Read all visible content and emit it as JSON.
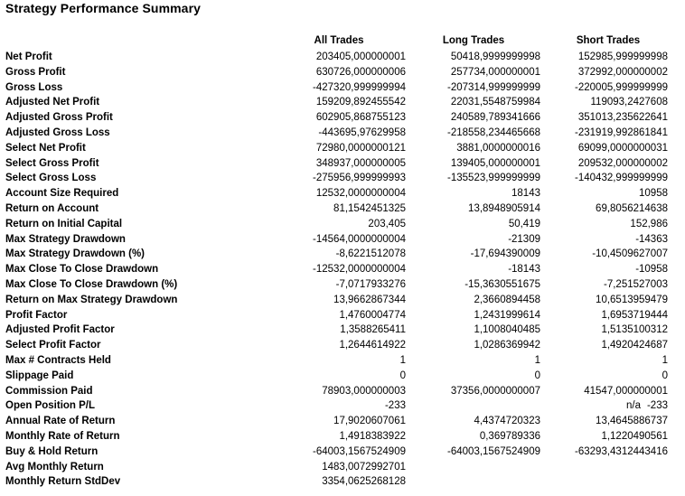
{
  "report": {
    "title": "Strategy Performance Summary",
    "columns": [
      "",
      "All Trades",
      "Long Trades",
      "Short Trades"
    ],
    "rows": [
      {
        "label": "Net Profit",
        "all": "203405,000000001",
        "long": "50418,9999999998",
        "short": "152985,999999998"
      },
      {
        "label": "Gross Profit",
        "all": "630726,000000006",
        "long": "257734,000000001",
        "short": "372992,000000002"
      },
      {
        "label": "Gross Loss",
        "all": "-427320,999999994",
        "long": "-207314,999999999",
        "short": "-220005,999999999"
      },
      {
        "label": "Adjusted Net Profit",
        "all": "159209,892455542",
        "long": "22031,5548759984",
        "short": "119093,2427608"
      },
      {
        "label": "Adjusted Gross Profit",
        "all": "602905,868755123",
        "long": "240589,789341666",
        "short": "351013,235622641"
      },
      {
        "label": "Adjusted Gross Loss",
        "all": "-443695,97629958",
        "long": "-218558,234465668",
        "short": "-231919,992861841"
      },
      {
        "label": "Select Net Profit",
        "all": "72980,0000000121",
        "long": "3881,0000000016",
        "short": "69099,0000000031"
      },
      {
        "label": "Select Gross Profit",
        "all": "348937,000000005",
        "long": "139405,000000001",
        "short": "209532,000000002"
      },
      {
        "label": "Select Gross Loss",
        "all": "-275956,999999993",
        "long": "-135523,999999999",
        "short": "-140432,999999999"
      },
      {
        "label": "Account Size Required",
        "all": "12532,0000000004",
        "long": "18143",
        "short": "10958"
      },
      {
        "label": "Return on Account",
        "all": "81,1542451325",
        "long": "13,8948905914",
        "short": "69,8056214638"
      },
      {
        "label": "Return on Initial Capital",
        "all": "203,405",
        "long": "50,419",
        "short": "152,986"
      },
      {
        "label": "Max Strategy Drawdown",
        "all": "-14564,0000000004",
        "long": "-21309",
        "short": "-14363"
      },
      {
        "label": "Max Strategy Drawdown (%)",
        "all": "-8,6221512078",
        "long": "-17,694390009",
        "short": "-10,4509627007"
      },
      {
        "label": "Max Close To Close Drawdown",
        "all": "-12532,0000000004",
        "long": "-18143",
        "short": "-10958"
      },
      {
        "label": "Max Close To Close Drawdown (%)",
        "all": "-7,0717933276",
        "long": "-15,3630551675",
        "short": "-7,251527003"
      },
      {
        "label": "Return on Max Strategy Drawdown",
        "all": "13,9662867344",
        "long": "2,3660894458",
        "short": "10,6513959479"
      },
      {
        "label": "Profit Factor",
        "all": "1,4760004774",
        "long": "1,2431999614",
        "short": "1,6953719444"
      },
      {
        "label": "Adjusted Profit Factor",
        "all": "1,3588265411",
        "long": "1,1008040485",
        "short": "1,5135100312"
      },
      {
        "label": "Select Profit Factor",
        "all": "1,2644614922",
        "long": "1,0286369942",
        "short": "1,4920424687"
      },
      {
        "label": "Max # Contracts Held",
        "all": "1",
        "long": "1",
        "short": "1"
      },
      {
        "label": "Slippage Paid",
        "all": "0",
        "long": "0",
        "short": "0"
      },
      {
        "label": "Commission Paid",
        "all": "78903,000000003",
        "long": "37356,0000000007",
        "short": "41547,000000001"
      },
      {
        "label": "Open Position P/L",
        "all": "-233",
        "all_suffix": "n/a",
        "long": "",
        "short": "-233"
      },
      {
        "label": "Annual Rate of Return",
        "all": "17,9020607061",
        "long": "4,4374720323",
        "short": "13,4645886737"
      },
      {
        "label": "Monthly Rate of Return",
        "all": "1,4918383922",
        "long": "0,369789336",
        "short": "1,1220490561"
      },
      {
        "label": "Buy & Hold Return",
        "all": "-64003,1567524909",
        "long": "-64003,1567524909",
        "short": "-63293,4312443416"
      },
      {
        "label": "Avg Monthly Return",
        "all": "1483,0072992701",
        "long": "",
        "short": ""
      },
      {
        "label": "Monthly Return StdDev",
        "all": "3354,0625268128",
        "long": "",
        "short": ""
      }
    ]
  },
  "colors": {
    "background": "#ffffff",
    "text": "#000000"
  }
}
